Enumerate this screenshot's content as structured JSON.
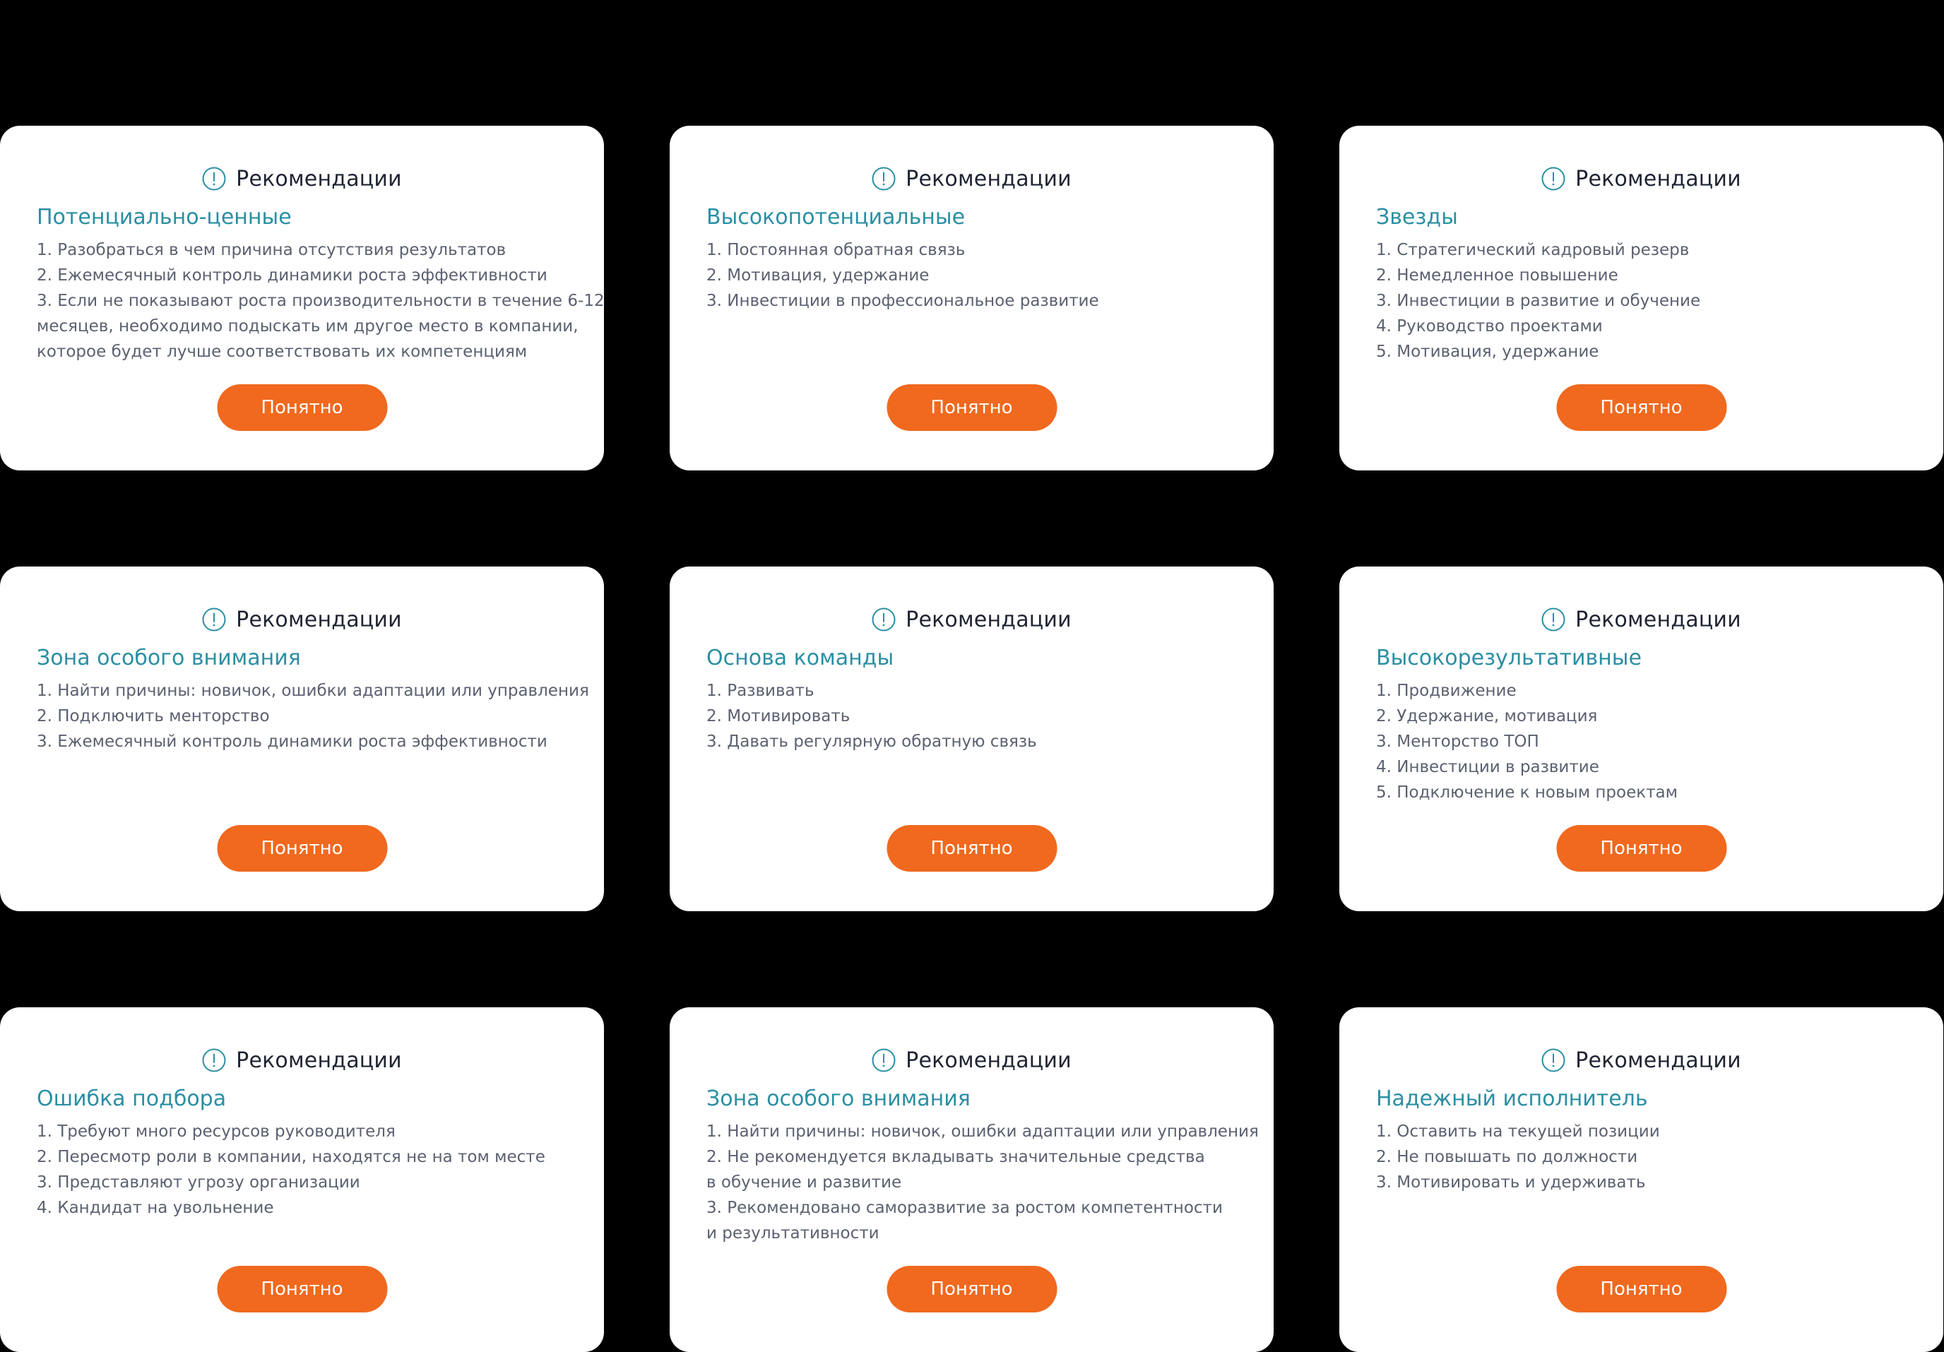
{
  "colors": {
    "background": "#000000",
    "card": "#ffffff",
    "accent_title": "#2a8fa3",
    "button": "#f0691e",
    "icon": "#2a8fa3"
  },
  "cards": [
    {
      "header": "Рекомендации",
      "icon": "info-circle-exclamation-icon",
      "title": "Потенциально-ценные",
      "lines": [
        "1. Разобраться в чем причина отсутствия результатов",
        "2. Ежемесячный контроль динамики роста эффективности",
        "3. Если не показывают роста производительности в течение 6-12",
        "месяцев, необходимо подыскать им другое место в компании,",
        "которое будет лучше соответствовать их компетенциям"
      ],
      "button": "Понятно"
    },
    {
      "header": "Рекомендации",
      "icon": "info-circle-exclamation-icon",
      "title": "Высокопотенциальные",
      "lines": [
        "1. Постоянная обратная связь",
        "2. Мотивация, удержание",
        "3. Инвестиции в профессиональное развитие"
      ],
      "button": "Понятно"
    },
    {
      "header": "Рекомендации",
      "icon": "info-circle-exclamation-icon",
      "title": "Звезды",
      "lines": [
        "1. Стратегический кадровый резерв",
        "2. Немедленное повышение",
        "3. Инвестиции в развитие и обучение",
        "4. Руководство проектами",
        "5. Мотивация, удержание"
      ],
      "button": "Понятно"
    },
    {
      "header": "Рекомендации",
      "icon": "info-circle-exclamation-icon",
      "title": "Зона особого внимания",
      "lines": [
        "1. Найти причины: новичок, ошибки адаптации или управления",
        "2. Подключить менторство",
        "3. Ежемесячный контроль динамики роста эффективности"
      ],
      "button": "Понятно"
    },
    {
      "header": "Рекомендации",
      "icon": "info-circle-exclamation-icon",
      "title": "Основа команды",
      "lines": [
        "1. Развивать",
        "2. Мотивировать",
        "3. Давать регулярную обратную связь"
      ],
      "button": "Понятно"
    },
    {
      "header": "Рекомендации",
      "icon": "info-circle-exclamation-icon",
      "title": "Высокорезультативные",
      "lines": [
        "1. Продвижение",
        "2. Удержание, мотивация",
        "3. Менторство ТОП",
        "4. Инвестиции в развитие",
        "5. Подключение к новым проектам"
      ],
      "button": "Понятно"
    },
    {
      "header": "Рекомендации",
      "icon": "info-circle-exclamation-icon",
      "title": "Ошибка подбора",
      "lines": [
        "1. Требуют много ресурсов руководителя",
        "2. Пересмотр роли в компании, находятся не на том месте",
        "3. Представляют угрозу организации",
        "4. Кандидат на увольнение"
      ],
      "button": "Понятно"
    },
    {
      "header": "Рекомендации",
      "icon": "info-circle-exclamation-icon",
      "title": "Зона особого внимания",
      "lines": [
        "1. Найти причины: новичок, ошибки адаптации или управления",
        "2. Не рекомендуется вкладывать значительные средства",
        "в обучение и развитие",
        "3. Рекомендовано саморазвитие за ростом компетентности",
        "и результативности"
      ],
      "button": "Понятно"
    },
    {
      "header": "Рекомендации",
      "icon": "info-circle-exclamation-icon",
      "title": "Надежный исполнитель",
      "lines": [
        "1. Оставить на текущей позиции",
        "2. Не повышать по должности",
        "3. Мотивировать и удерживать"
      ],
      "button": "Понятно"
    }
  ]
}
